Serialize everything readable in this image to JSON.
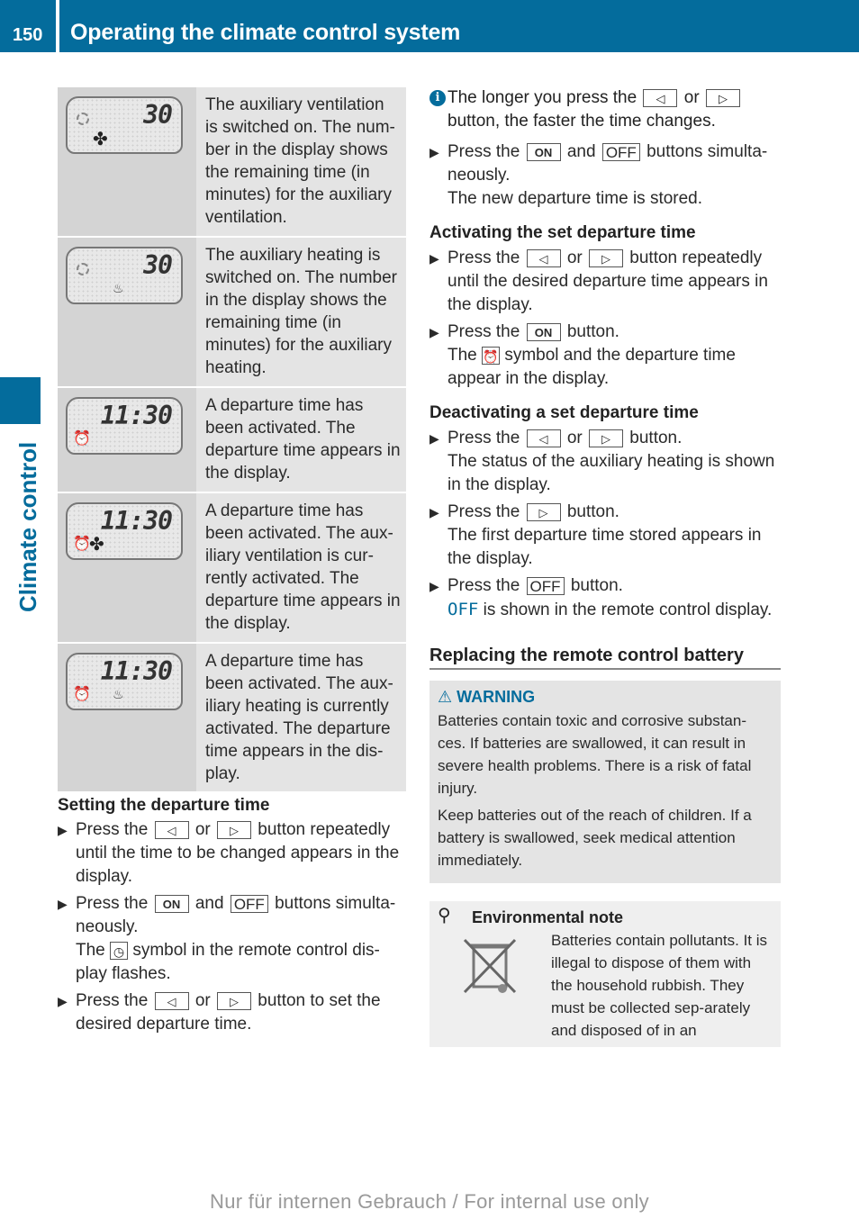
{
  "header": {
    "page_number": "150",
    "title": "Operating the climate control system"
  },
  "side_tab": {
    "label": "Climate control"
  },
  "display_table": [
    {
      "lcd": {
        "value": "30",
        "icons": [
          "clock-icon",
          "fan-icon"
        ]
      },
      "text": "The auxiliary ventilation is switched on. The num-ber in the display shows the remaining time (in minutes) for the auxiliary ventilation."
    },
    {
      "lcd": {
        "value": "30",
        "icons": [
          "clock-icon",
          "heating-icon"
        ]
      },
      "text": "The auxiliary heating is switched on. The number in the display shows the remaining time (in minutes) for the auxiliary heating."
    },
    {
      "lcd": {
        "value": "11:30",
        "icons": [
          "alarm-clock-icon"
        ]
      },
      "text": "A departure time has been activated. The departure time appears in the display."
    },
    {
      "lcd": {
        "value": "11:30",
        "icons": [
          "alarm-clock-icon",
          "fan-icon"
        ]
      },
      "text": "A departure time has been activated. The aux-iliary ventilation is cur-rently activated. The departure time appears in the display."
    },
    {
      "lcd": {
        "value": "11:30",
        "icons": [
          "alarm-clock-icon",
          "heating-icon"
        ]
      },
      "text": "A departure time has been activated. The aux-iliary heating is currently activated. The departure time appears in the dis-play."
    }
  ],
  "keys": {
    "left": "◁",
    "right": "▷",
    "on": "ON",
    "off": "OFF"
  },
  "words": {
    "press_the": "Press the",
    "or": "or",
    "and": "and",
    "the": "The"
  },
  "setting": {
    "heading": "Setting the departure time",
    "step1_tail": "button repeatedly until the time to be changed appears in the display.",
    "step2_tail": "buttons simulta-neously.",
    "step2_result_tail": "symbol in the remote control dis-play flashes.",
    "step3_tail": "button to set the desired departure time."
  },
  "info_note": {
    "head": "The longer you press the",
    "tail": "button, the faster the time changes."
  },
  "store": {
    "tail": "buttons simulta-neously.",
    "result": "The new departure time is stored."
  },
  "activating": {
    "heading": "Activating the set departure time",
    "step1_tail": "button repeatedly until the desired departure time appears in the display.",
    "step2_tail": "button.",
    "step2_result_tail": "symbol and the departure time appear in the display."
  },
  "deactivating": {
    "heading": "Deactivating a set departure time",
    "step1_tail": "button.",
    "step1_result": "The status of the auxiliary heating is shown in the display.",
    "step2_tail": "button.",
    "step2_result": "The first departure time stored appears in the display.",
    "step3_tail": "button.",
    "step3_result_highlight": "OFF",
    "step3_result_tail": "is shown in the remote control display."
  },
  "battery": {
    "heading": "Replacing the remote control battery",
    "warning": {
      "title": "WARNING",
      "p1": "Batteries contain toxic and corrosive substan-ces. If batteries are swallowed, it can result in severe health problems. There is a risk of fatal injury.",
      "p2": "Keep batteries out of the reach of children. If a battery is swallowed, seek medical attention immediately."
    },
    "env_note": {
      "title": "Environmental note",
      "text": "Batteries contain pollutants. It is illegal to dispose of them with the household rubbish. They must be collected sep-arately and disposed of in an"
    }
  },
  "footer": {
    "text": "Nur für internen Gebrauch / For internal use only"
  },
  "colors": {
    "brand_blue": "#046c9c"
  }
}
